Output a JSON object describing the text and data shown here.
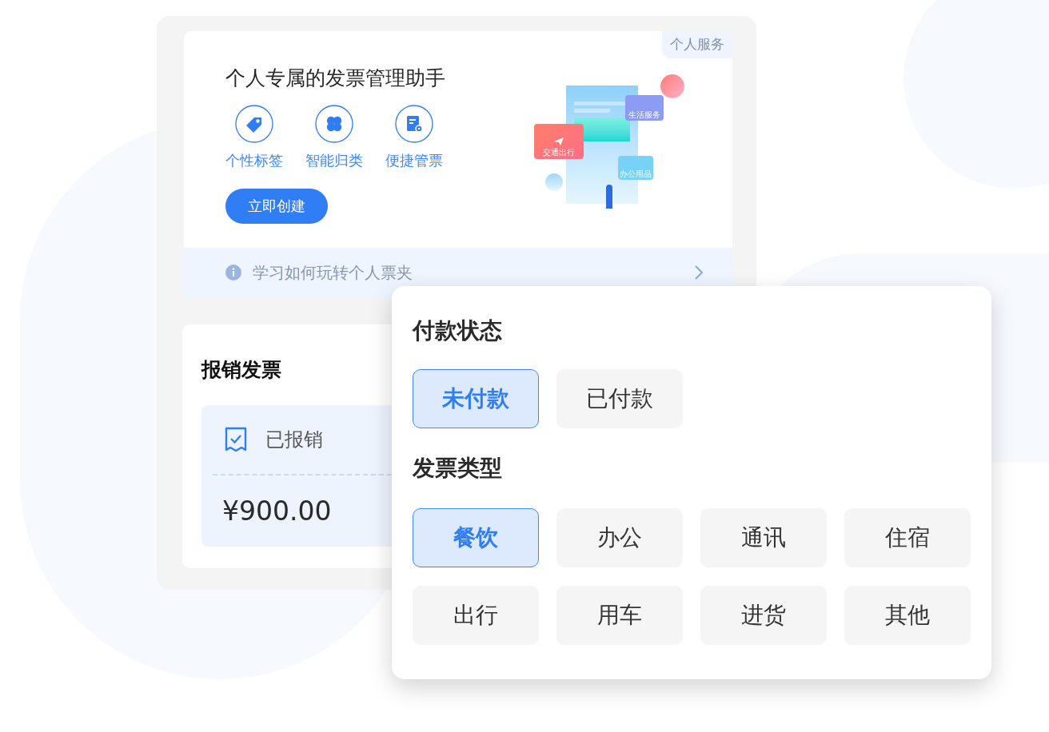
{
  "hero": {
    "badge": "个人服务",
    "title": "个人专属的发票管理助手",
    "features": [
      {
        "label": "个性标签",
        "kind": "tag"
      },
      {
        "label": "智能归类",
        "kind": "clover"
      },
      {
        "label": "便捷管票",
        "kind": "document"
      }
    ],
    "button": "立即创建",
    "illustration": {
      "labels": [
        "生活服务",
        "交通出行",
        "办公用品"
      ]
    },
    "tip": "学习如何玩转个人票夹"
  },
  "reimbursement": {
    "title": "报销发票",
    "ticket": {
      "status": "已报销",
      "checked": true,
      "amount": "¥900.00"
    }
  },
  "filter": {
    "sections": [
      {
        "title": "付款状态",
        "options": [
          {
            "label": "未付款",
            "selected": true
          },
          {
            "label": "已付款",
            "selected": false
          }
        ]
      },
      {
        "title": "发票类型",
        "options": [
          {
            "label": "餐饮",
            "selected": true
          },
          {
            "label": "办公",
            "selected": false
          },
          {
            "label": "通讯",
            "selected": false
          },
          {
            "label": "住宿",
            "selected": false
          },
          {
            "label": "出行",
            "selected": false
          },
          {
            "label": "用车",
            "selected": false
          },
          {
            "label": "进货",
            "selected": false
          },
          {
            "label": "其他",
            "selected": false
          }
        ]
      }
    ]
  }
}
